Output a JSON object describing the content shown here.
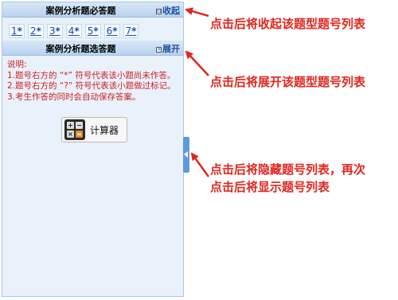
{
  "sections": [
    {
      "title": "案例分析题必答题",
      "toggle_label": "收起",
      "toggle_symbol": "⊟"
    },
    {
      "title": "案例分析题选答题",
      "toggle_label": "展开",
      "toggle_symbol": "+"
    }
  ],
  "question_numbers": [
    {
      "num": "1",
      "mark": "*"
    },
    {
      "num": "2",
      "mark": "*"
    },
    {
      "num": "3",
      "mark": "*"
    },
    {
      "num": "4",
      "mark": "*"
    },
    {
      "num": "5",
      "mark": "*"
    },
    {
      "num": "6",
      "mark": "*"
    },
    {
      "num": "7",
      "mark": "*"
    }
  ],
  "notes": {
    "heading": "说明:",
    "line1": "1.题号右方的 “*” 符号代表该小题尚未作答。",
    "line2": "2.题号右方的 “?” 符号代表该小题做过标记。",
    "line3": "3.考生作答的同时会自动保存答案。"
  },
  "calculator": {
    "label": "计算器",
    "icon": "calculator-icon",
    "keys": [
      "+",
      "−",
      "×",
      "="
    ]
  },
  "annotations": {
    "collapse": "点击后将收起该题型题号列表",
    "expand": "点击后将展开该题型题号列表",
    "hide_line1": "点击后将隐藏题号列表，再次",
    "hide_line2": "点击后将显示题号列表"
  },
  "colors": {
    "annotation_red": "#e0261f",
    "accent_blue": "#1e4fa0",
    "handle_blue": "#5b9bdd"
  }
}
